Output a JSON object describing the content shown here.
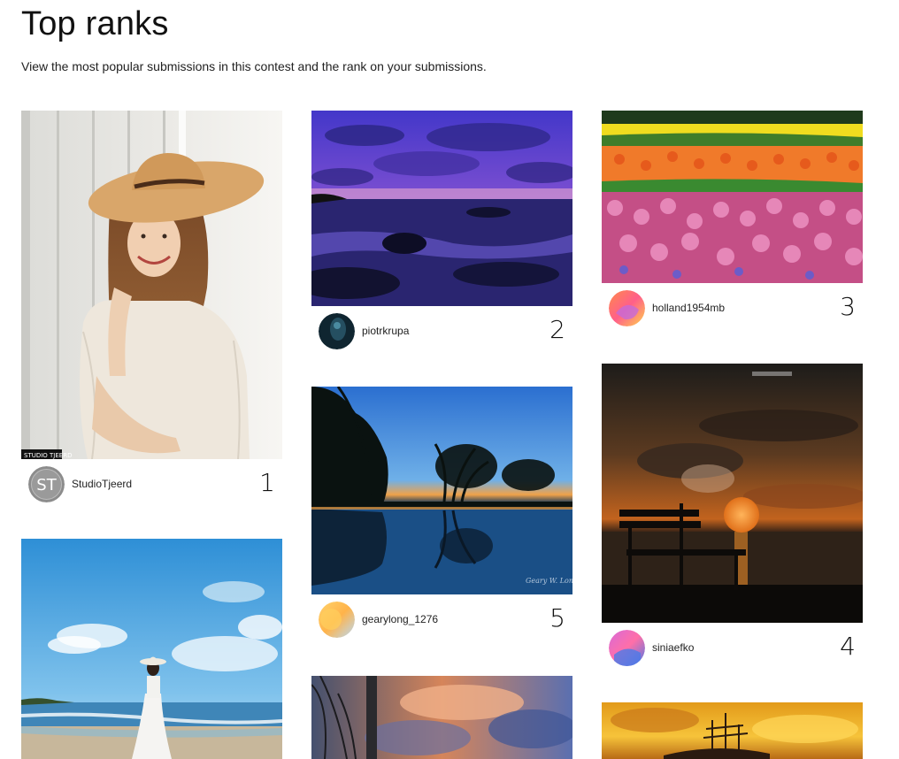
{
  "page": {
    "title": "Top ranks",
    "subtitle": "View the most popular submissions in this contest and the rank on your submissions."
  },
  "submissions": [
    {
      "username": "StudioTjeerd",
      "rank": "1",
      "avatar_initials": "ST",
      "watermark": "STUDIO TJEERD",
      "photo": "girl-with-straw-hat"
    },
    {
      "username": "piotrkrupa",
      "rank": "2",
      "photo": "purple-sunset-seascape"
    },
    {
      "username": "holland1954mb",
      "rank": "3",
      "photo": "tulip-and-hyacinth-field"
    },
    {
      "username": "siniaefko",
      "rank": "4",
      "photo": "bench-and-moon-sunset"
    },
    {
      "username": "gearylong_1276",
      "rank": "5",
      "photo": "tree-silhouette-lake-reflection"
    },
    {
      "username": "",
      "rank": "",
      "photo": "woman-in-white-on-beach"
    },
    {
      "username": "",
      "rank": "",
      "photo": "dramatic-sky-with-pole"
    },
    {
      "username": "",
      "rank": "",
      "photo": "golden-sky-shipwreck"
    }
  ]
}
